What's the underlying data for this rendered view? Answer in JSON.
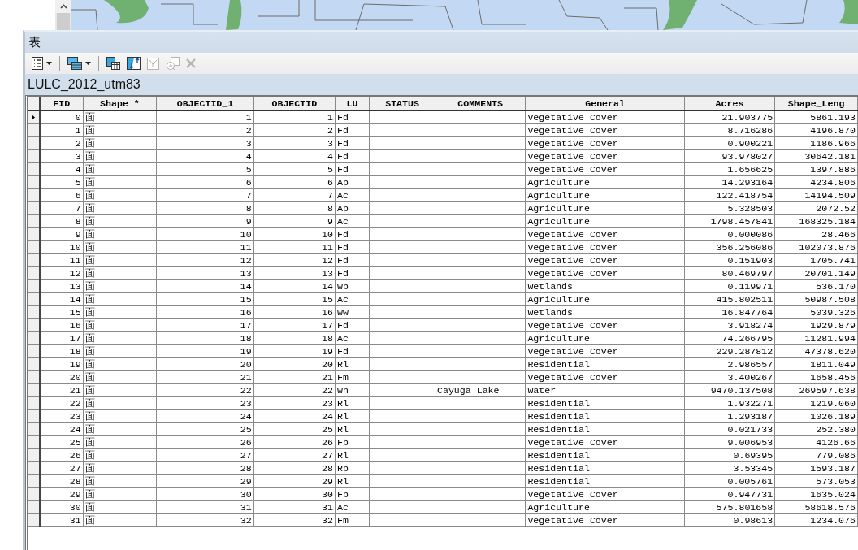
{
  "window": {
    "title": "表"
  },
  "toolbar": [
    {
      "kind": "table-options",
      "dropdown": true,
      "disabled": false
    },
    {
      "kind": "separator"
    },
    {
      "kind": "related-tables",
      "dropdown": true,
      "disabled": false
    },
    {
      "kind": "separator"
    },
    {
      "kind": "select-by-attributes",
      "dropdown": false,
      "disabled": false
    },
    {
      "kind": "switch-selection",
      "dropdown": false,
      "disabled": false
    },
    {
      "kind": "clear-selection",
      "dropdown": false,
      "disabled": true
    },
    {
      "kind": "zoom-to-selected",
      "dropdown": false,
      "disabled": true
    },
    {
      "kind": "delete-selected",
      "dropdown": false,
      "disabled": true
    }
  ],
  "table": {
    "name": "LULC_2012_utm83",
    "columns": [
      {
        "label": "FID",
        "kind": "number"
      },
      {
        "label": "Shape *",
        "kind": "text"
      },
      {
        "label": "OBJECTID_1",
        "kind": "number"
      },
      {
        "label": "OBJECTID",
        "kind": "number"
      },
      {
        "label": "LU",
        "kind": "text"
      },
      {
        "label": "STATUS",
        "kind": "text"
      },
      {
        "label": "COMMENTS",
        "kind": "text"
      },
      {
        "label": "General",
        "kind": "text"
      },
      {
        "label": "Acres",
        "kind": "number"
      },
      {
        "label": "Shape_Leng",
        "kind": "number"
      }
    ],
    "rows": [
      {
        "current": true,
        "cells": [
          "0",
          "面",
          "1",
          "1",
          "Fd",
          null,
          null,
          "Vegetative Cover",
          "21.903775",
          "5861.193"
        ]
      },
      {
        "current": false,
        "cells": [
          "1",
          "面",
          "2",
          "2",
          "Fd",
          null,
          null,
          "Vegetative Cover",
          "8.716286",
          "4196.870"
        ]
      },
      {
        "current": false,
        "cells": [
          "2",
          "面",
          "3",
          "3",
          "Fd",
          null,
          null,
          "Vegetative Cover",
          "0.900221",
          "1186.966"
        ]
      },
      {
        "current": false,
        "cells": [
          "3",
          "面",
          "4",
          "4",
          "Fd",
          null,
          null,
          "Vegetative Cover",
          "93.978027",
          "30642.181"
        ]
      },
      {
        "current": false,
        "cells": [
          "4",
          "面",
          "5",
          "5",
          "Fd",
          null,
          null,
          "Vegetative Cover",
          "1.656625",
          "1397.886"
        ]
      },
      {
        "current": false,
        "cells": [
          "5",
          "面",
          "6",
          "6",
          "Ap",
          null,
          null,
          "Agriculture",
          "14.293164",
          "4234.806"
        ]
      },
      {
        "current": false,
        "cells": [
          "6",
          "面",
          "7",
          "7",
          "Ac",
          null,
          null,
          "Agriculture",
          "122.418754",
          "14194.509"
        ]
      },
      {
        "current": false,
        "cells": [
          "7",
          "面",
          "8",
          "8",
          "Ap",
          null,
          null,
          "Agriculture",
          "5.328503",
          "2072.52"
        ]
      },
      {
        "current": false,
        "cells": [
          "8",
          "面",
          "9",
          "9",
          "Ac",
          null,
          null,
          "Agriculture",
          "1798.457841",
          "168325.184"
        ]
      },
      {
        "current": false,
        "cells": [
          "9",
          "面",
          "10",
          "10",
          "Fd",
          null,
          null,
          "Vegetative Cover",
          "0.000086",
          "28.466"
        ]
      },
      {
        "current": false,
        "cells": [
          "10",
          "面",
          "11",
          "11",
          "Fd",
          null,
          null,
          "Vegetative Cover",
          "356.256086",
          "102073.876"
        ]
      },
      {
        "current": false,
        "cells": [
          "11",
          "面",
          "12",
          "12",
          "Fd",
          null,
          null,
          "Vegetative Cover",
          "0.151903",
          "1705.741"
        ]
      },
      {
        "current": false,
        "cells": [
          "12",
          "面",
          "13",
          "13",
          "Fd",
          null,
          null,
          "Vegetative Cover",
          "80.469797",
          "20701.149"
        ]
      },
      {
        "current": false,
        "cells": [
          "13",
          "面",
          "14",
          "14",
          "Wb",
          null,
          null,
          "Wetlands",
          "0.119971",
          "536.170"
        ]
      },
      {
        "current": false,
        "cells": [
          "14",
          "面",
          "15",
          "15",
          "Ac",
          null,
          null,
          "Agriculture",
          "415.802511",
          "50987.508"
        ]
      },
      {
        "current": false,
        "cells": [
          "15",
          "面",
          "16",
          "16",
          "Ww",
          null,
          null,
          "Wetlands",
          "16.847764",
          "5039.326"
        ]
      },
      {
        "current": false,
        "cells": [
          "16",
          "面",
          "17",
          "17",
          "Fd",
          null,
          null,
          "Vegetative Cover",
          "3.918274",
          "1929.879"
        ]
      },
      {
        "current": false,
        "cells": [
          "17",
          "面",
          "18",
          "18",
          "Ac",
          null,
          null,
          "Agriculture",
          "74.266795",
          "11281.994"
        ]
      },
      {
        "current": false,
        "cells": [
          "18",
          "面",
          "19",
          "19",
          "Fd",
          null,
          null,
          "Vegetative Cover",
          "229.287812",
          "47378.620"
        ]
      },
      {
        "current": false,
        "cells": [
          "19",
          "面",
          "20",
          "20",
          "Rl",
          null,
          null,
          "Residential",
          "2.986557",
          "1811.049"
        ]
      },
      {
        "current": false,
        "cells": [
          "20",
          "面",
          "21",
          "21",
          "Fm",
          null,
          null,
          "Vegetative Cover",
          "3.400267",
          "1658.456"
        ]
      },
      {
        "current": false,
        "cells": [
          "21",
          "面",
          "22",
          "22",
          "Wn",
          null,
          "Cayuga Lake",
          "Water",
          "9470.137508",
          "269597.638"
        ]
      },
      {
        "current": false,
        "cells": [
          "22",
          "面",
          "23",
          "23",
          "Rl",
          null,
          null,
          "Residential",
          "1.932271",
          "1219.060"
        ]
      },
      {
        "current": false,
        "cells": [
          "23",
          "面",
          "24",
          "24",
          "Rl",
          null,
          null,
          "Residential",
          "1.293187",
          "1026.189"
        ]
      },
      {
        "current": false,
        "cells": [
          "24",
          "面",
          "25",
          "25",
          "Rl",
          null,
          null,
          "Residential",
          "0.021733",
          "252.380"
        ]
      },
      {
        "current": false,
        "cells": [
          "25",
          "面",
          "26",
          "26",
          "Fb",
          null,
          null,
          "Vegetative Cover",
          "9.006953",
          "4126.66"
        ]
      },
      {
        "current": false,
        "cells": [
          "26",
          "面",
          "27",
          "27",
          "Rl",
          null,
          null,
          "Residential",
          "0.69395",
          "779.086"
        ]
      },
      {
        "current": false,
        "cells": [
          "27",
          "面",
          "28",
          "28",
          "Rp",
          null,
          null,
          "Residential",
          "3.53345",
          "1593.187"
        ]
      },
      {
        "current": false,
        "cells": [
          "28",
          "面",
          "29",
          "29",
          "Rl",
          null,
          null,
          "Residential",
          "0.005761",
          "573.053"
        ]
      },
      {
        "current": false,
        "cells": [
          "29",
          "面",
          "30",
          "30",
          "Fb",
          null,
          null,
          "Vegetative Cover",
          "0.947731",
          "1635.024"
        ]
      },
      {
        "current": false,
        "cells": [
          "30",
          "面",
          "31",
          "31",
          "Ac",
          null,
          null,
          "Agriculture",
          "575.801658",
          "58618.576"
        ]
      },
      {
        "current": false,
        "cells": [
          "31",
          "面",
          "32",
          "32",
          "Fm",
          null,
          null,
          "Vegetative Cover",
          "0.98613",
          "1234.076"
        ]
      }
    ]
  }
}
